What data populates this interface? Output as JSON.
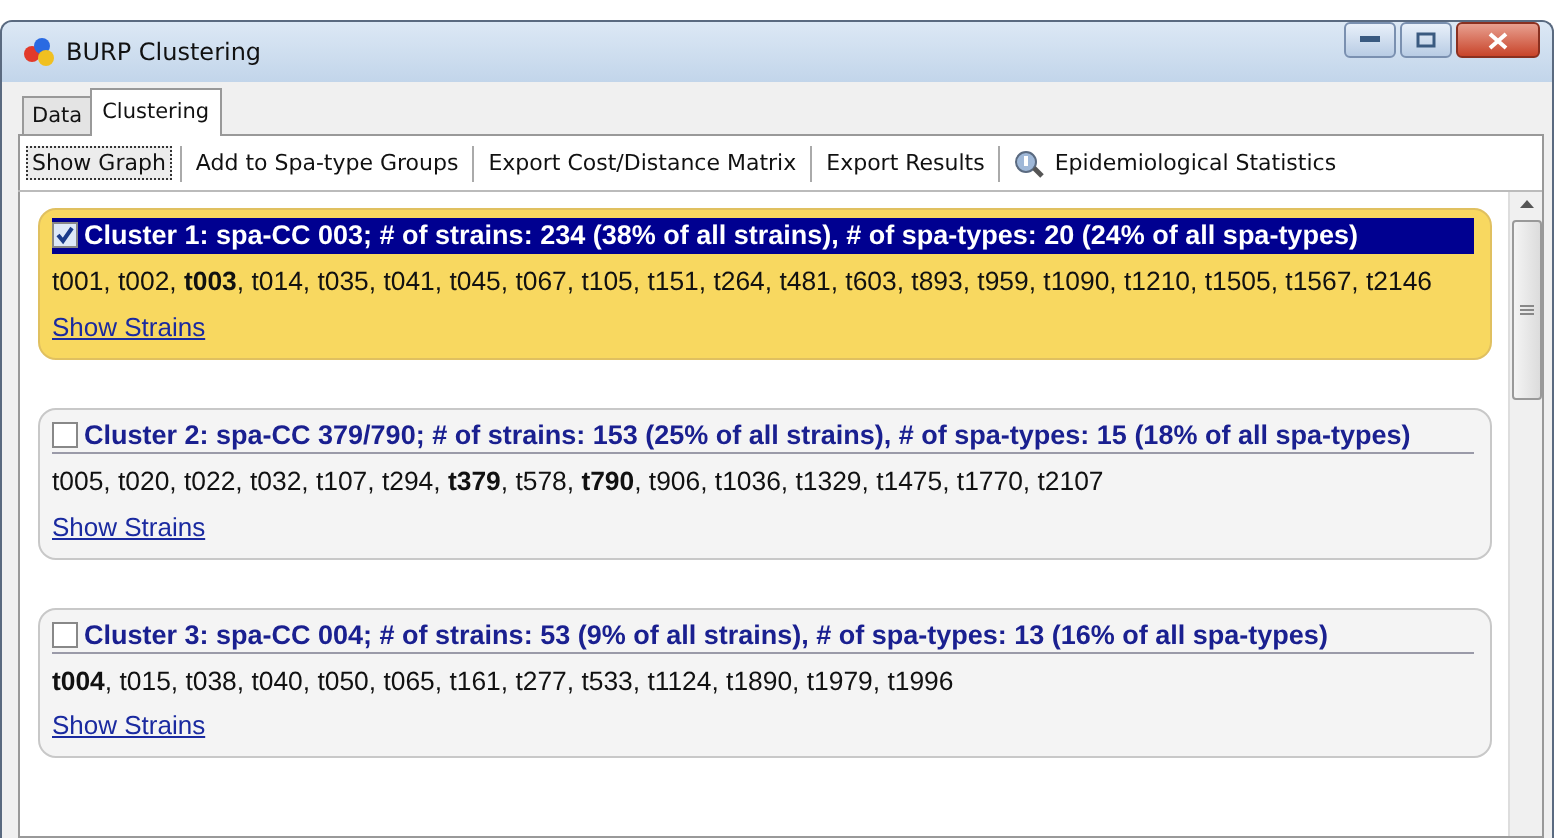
{
  "window": {
    "title": "BURP Clustering"
  },
  "tabs": [
    {
      "label": "Data",
      "selected": false
    },
    {
      "label": "Clustering",
      "selected": true
    }
  ],
  "toolbar": [
    {
      "label": "Show Graph",
      "focused": true
    },
    {
      "label": "Add to Spa-type Groups",
      "focused": false
    },
    {
      "label": "Export Cost/Distance Matrix",
      "focused": false
    },
    {
      "label": "Export Results",
      "focused": false
    },
    {
      "label": "Epidemiological Statistics",
      "focused": false,
      "kind": "icon-label"
    }
  ],
  "clusters": [
    {
      "title": "Cluster 1: spa-CC 003; # of strains: 234 (38% of all strains), # of spa-types: 20 (24% of all spa-types)",
      "checked": true,
      "spa_types": "t001, t002, **t003**, t014, t035, t041, t045, t067, t105, t151, t264, t481, t603, t893, t959, t1090, t1210, t1505, t1567, t2146",
      "link": "Show Strains"
    },
    {
      "title": "Cluster 2: spa-CC 379/790; # of strains: 153 (25% of all strains), # of spa-types: 15 (18% of all spa-types)",
      "checked": false,
      "spa_types": "t005, t020, t022, t032, t107, t294, **t379**, t578, **t790**, t906, t1036, t1329, t1475, t1770, t2107",
      "link": "Show Strains"
    },
    {
      "title": "Cluster 3: spa-CC 004; # of strains: 53 (9% of all strains), # of spa-types: 13 (16% of all spa-types)",
      "checked": false,
      "spa_types": "**t004**, t015, t038, t040, t050, t065, t161, t277, t533, t1124, t1890, t1979, t1996",
      "link": "Show Strains"
    }
  ]
}
